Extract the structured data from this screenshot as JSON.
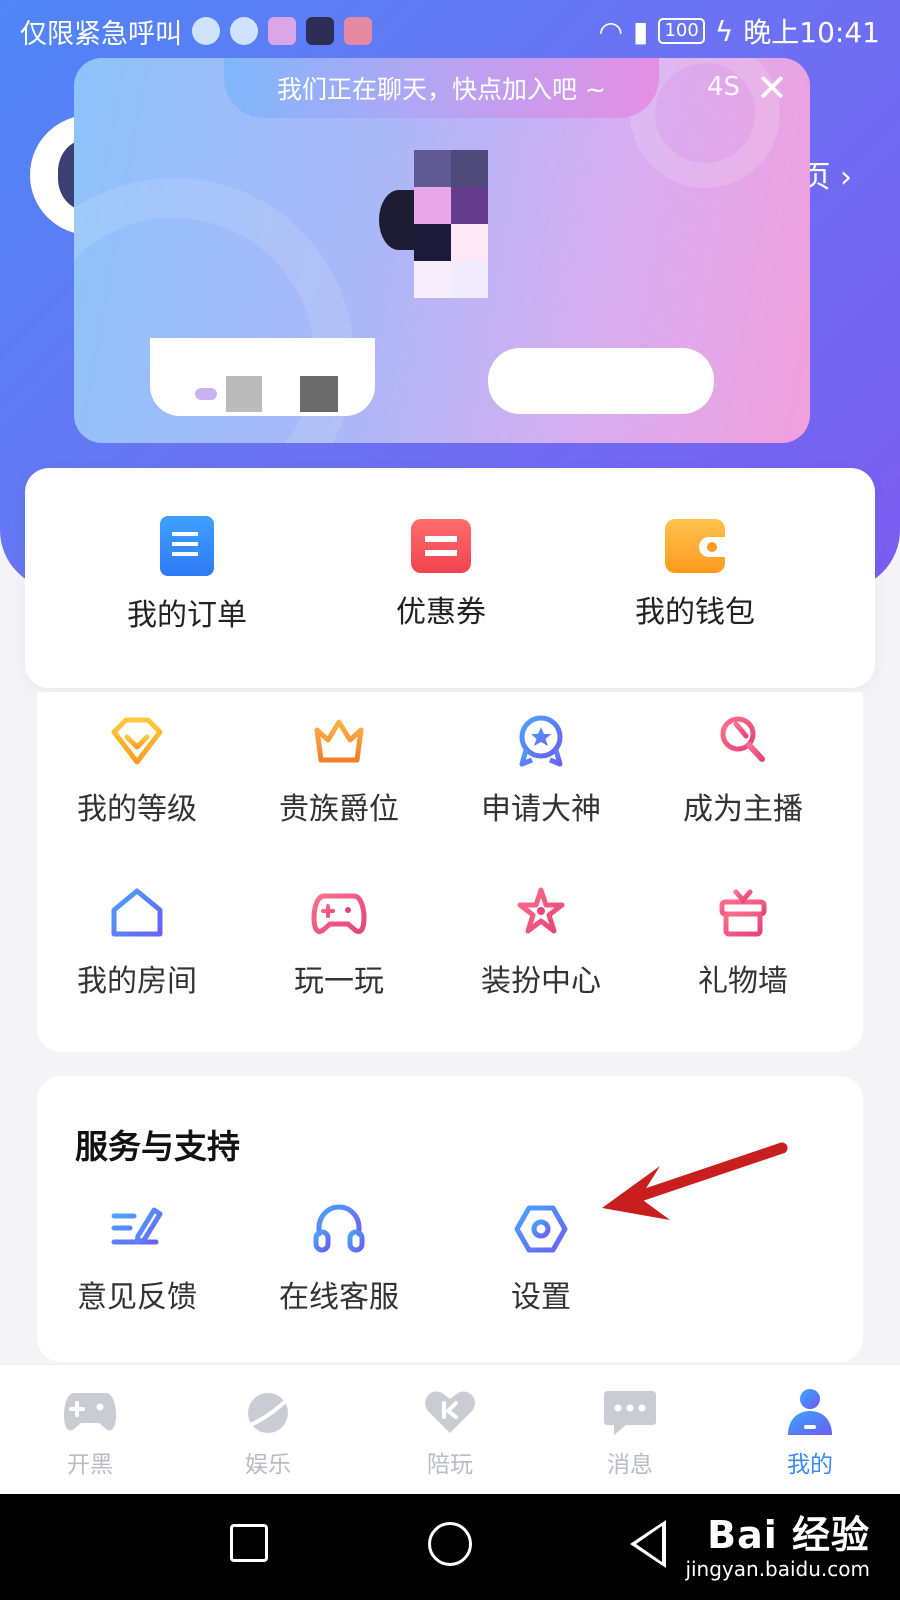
{
  "status_bar": {
    "carrier_text": "仅限紧急呼叫",
    "battery": "100",
    "time": "晚上10:41"
  },
  "profile": {
    "link_text": "页 ›"
  },
  "popup": {
    "header": "我们正在聊天，快点加入吧 ~",
    "countdown": "4S",
    "close": "✕"
  },
  "top_items": [
    {
      "label": "我的订单",
      "icon": "order-doc-icon"
    },
    {
      "label": "优惠券",
      "icon": "coupon-ticket-icon"
    },
    {
      "label": "我的钱包",
      "icon": "wallet-icon"
    }
  ],
  "grid_items": [
    {
      "label": "我的等级",
      "icon": "level-diamond-icon"
    },
    {
      "label": "贵族爵位",
      "icon": "crown-icon"
    },
    {
      "label": "申请大神",
      "icon": "medal-icon"
    },
    {
      "label": "成为主播",
      "icon": "microphone-icon"
    },
    {
      "label": "我的房间",
      "icon": "house-icon"
    },
    {
      "label": "玩一玩",
      "icon": "gamepad-icon"
    },
    {
      "label": "装扮中心",
      "icon": "star-icon"
    },
    {
      "label": "礼物墙",
      "icon": "gift-icon"
    }
  ],
  "service": {
    "title": "服务与支持",
    "items": [
      {
        "label": "意见反馈",
        "icon": "feedback-pen-icon"
      },
      {
        "label": "在线客服",
        "icon": "headset-icon"
      },
      {
        "label": "设置",
        "icon": "settings-hex-icon"
      }
    ]
  },
  "tabs": [
    {
      "label": "开黑",
      "icon": "gamepad-tab-icon",
      "active": false
    },
    {
      "label": "娱乐",
      "icon": "planet-tab-icon",
      "active": false
    },
    {
      "label": "陪玩",
      "icon": "heart-tab-icon",
      "active": false
    },
    {
      "label": "消息",
      "icon": "chat-bubble-tab-icon",
      "active": false
    },
    {
      "label": "我的",
      "icon": "person-tab-icon",
      "active": true
    }
  ],
  "watermark": {
    "brand": "Bai 经验",
    "url": "jingyan.baidu.com"
  },
  "colors": {
    "accent": "#3a8bf6",
    "annotation_arrow": "#c81e1e"
  }
}
